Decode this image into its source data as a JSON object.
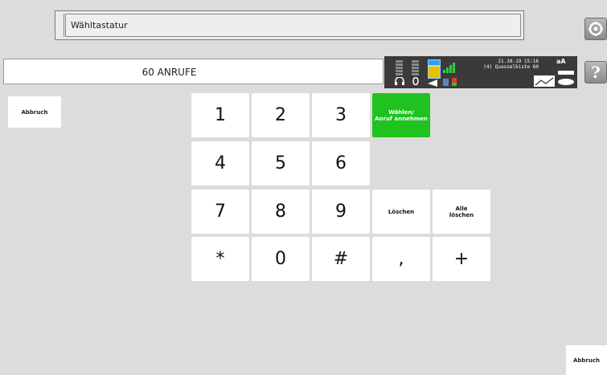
{
  "header": {
    "title": "Wähltastatur"
  },
  "display": {
    "text": "60 ANRUFE"
  },
  "status": {
    "date_line": "21.10.19 15:16",
    "contact_line": "(4) Quasselkiste 60",
    "font_label": "aA"
  },
  "help_button": {
    "label": "?"
  },
  "abort_left": {
    "label": "Abbruch"
  },
  "abort_right": {
    "label": "Abbruch"
  },
  "keys": {
    "k1": "1",
    "k2": "2",
    "k3": "3",
    "k4": "4",
    "k5": "5",
    "k6": "6",
    "k7": "7",
    "k8": "8",
    "k9": "9",
    "kstar": "*",
    "k0": "0",
    "khash": "#",
    "kcomma": ",",
    "kplus": "+"
  },
  "actions": {
    "dial_line1": "Wählen/",
    "dial_line2": "Anruf annehmen",
    "delete": "Löschen",
    "delete_all_line1": "Alle",
    "delete_all_line2": "löschen"
  },
  "colors": {
    "dial_green": "#1fc21f",
    "background": "#dcdcdc"
  },
  "icons": [
    "settings-icon",
    "help-icon",
    "headset-icon",
    "volume-icon",
    "battery-icon",
    "signal-icon",
    "chart-icon",
    "keyboard-icon"
  ]
}
